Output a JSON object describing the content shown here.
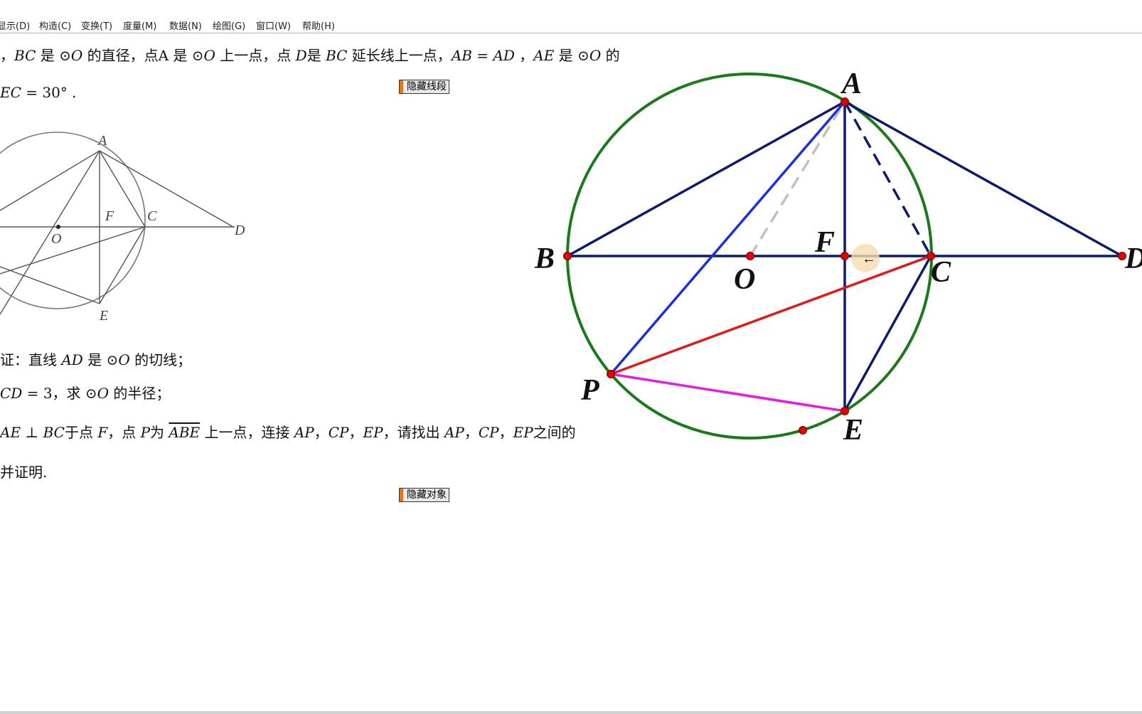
{
  "menu": {
    "items": [
      "显示(D)",
      "构造(C)",
      "变换(T)",
      "度量(M)",
      "数据(N)",
      "绘图(G)",
      "窗口(W)",
      "帮助(H)"
    ]
  },
  "problem": {
    "line1": {
      "p1": "，",
      "BC": "BC",
      "p2": " 是 ⊙",
      "O1": "O",
      "p3": " 的直径，点A 是 ⊙",
      "O2": "O",
      "p4": " 上一点，点 ",
      "D": "D",
      "p5": "是 ",
      "BC2": "BC",
      "p6": " 延长线上一点，",
      "AB": "AB",
      "eq": " = ",
      "AD": "AD",
      "p7": " ，",
      "AE": "AE",
      "p8": " 是 ⊙",
      "O3": "O",
      "p9": " 的"
    },
    "line2": {
      "EC": "EC",
      "rest": " = 30° ."
    },
    "q1": {
      "p1": "证：直线 ",
      "AD": "AD",
      "p2": " 是 ⊙",
      "O": "O",
      "p3": " 的切线；"
    },
    "q2": {
      "CD": "CD",
      "p1": " = 3，求 ⊙",
      "O": "O",
      "p2": " 的半径；"
    },
    "q3": {
      "AE": "AE",
      "perp": " ⊥ ",
      "BC": "BC",
      "p1": "于点 ",
      "F": "F",
      "p2": "，点 ",
      "P": "P",
      "p3": "为 ",
      "arc": "ABE",
      "p4": " 上一点，连接 ",
      "AP": "AP",
      "c1": "，",
      "CP": "CP",
      "c2": "，",
      "EP": "EP",
      "p5": "，请找出 ",
      "AP2": "AP",
      "c3": "，",
      "CP2": "CP",
      "c4": "，",
      "EP2": "EP",
      "p6": "之间的"
    },
    "q4": {
      "text": "并证明."
    }
  },
  "buttons": {
    "hide_segments": "隐藏线段",
    "hide_objects": "隐藏对象"
  },
  "small_figure_labels": {
    "A": "A",
    "F": "F",
    "C": "C",
    "D": "D",
    "O": "O",
    "E": "E"
  },
  "big_figure_labels": {
    "A": "A",
    "B": "B",
    "C": "C",
    "D": "D",
    "E": "E",
    "F": "F",
    "O": "O",
    "P": "P"
  },
  "colors": {
    "circle": "#1a7a1a",
    "segments": "#0d1a6e",
    "AP": "#1a2ee6",
    "PC": "#e01a1a",
    "PE": "#e61ae6",
    "hidden_OA": "#c0c0c0",
    "points": "#e00000"
  }
}
